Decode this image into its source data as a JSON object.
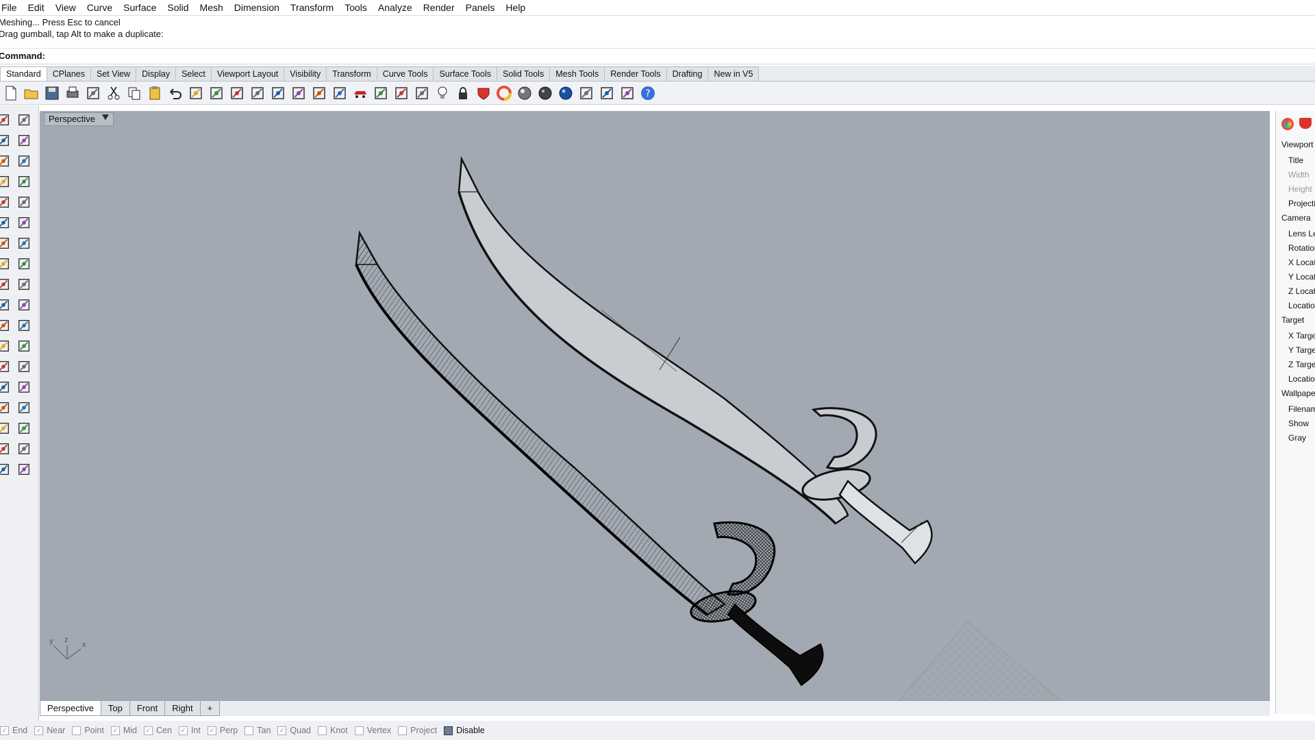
{
  "menu": [
    "File",
    "Edit",
    "View",
    "Curve",
    "Surface",
    "Solid",
    "Mesh",
    "Dimension",
    "Transform",
    "Tools",
    "Analyze",
    "Render",
    "Panels",
    "Help"
  ],
  "history": [
    "Meshing... Press Esc to cancel",
    "Drag gumball, tap Alt to make a duplicate:"
  ],
  "command_label": "Command:",
  "toolbar_tabs": [
    "Standard",
    "CPlanes",
    "Set View",
    "Display",
    "Select",
    "Viewport Layout",
    "Visibility",
    "Transform",
    "Curve Tools",
    "Surface Tools",
    "Solid Tools",
    "Mesh Tools",
    "Render Tools",
    "Drafting",
    "New in V5"
  ],
  "active_toolbar_tab": "Standard",
  "icons": [
    "new-icon",
    "open-icon",
    "save-icon",
    "print-icon",
    "import-icon",
    "cut-icon",
    "copy-icon",
    "paste-icon",
    "undo-icon",
    "pan-icon",
    "move-icon",
    "zoom-icon",
    "zoom-window-icon",
    "zoom-extents-icon",
    "zoom-selected-icon",
    "rotate-view-icon",
    "four-viewports-icon",
    "car-icon",
    "object-properties-icon",
    "circle-icon",
    "snap-icon",
    "light-icon",
    "lock-icon",
    "shield-icon",
    "color-wheel-icon",
    "sphere-icon",
    "sphere-dark-icon",
    "globe-icon",
    "filter-icon",
    "settings-icon",
    "dimension-icon",
    "help-icon"
  ],
  "left_icons": [
    "select-icon",
    "point-icon",
    "line-icon",
    "polyline-icon",
    "circle-icon",
    "curve-icon",
    "rectangle-icon",
    "arc-icon",
    "freeform-icon",
    "surface-icon",
    "box-icon",
    "extrude-icon",
    "loft-icon",
    "plane-icon",
    "boolean-icon",
    "mesh-icon",
    "edit-icon",
    "fillet-icon",
    "transform-icon",
    "grid-icon",
    "array-icon",
    "check-icon",
    "paint-icon"
  ],
  "viewport": {
    "title": "Perspective",
    "axes": {
      "y": "y",
      "z": "z",
      "x": "x"
    }
  },
  "properties": {
    "rows": [
      {
        "label": "Viewport",
        "type": "header"
      },
      {
        "label": "Title",
        "type": "item"
      },
      {
        "label": "Width",
        "type": "dim"
      },
      {
        "label": "Height",
        "type": "dim"
      },
      {
        "label": "Projection",
        "type": "item"
      },
      {
        "label": "Camera",
        "type": "header"
      },
      {
        "label": "Lens Length",
        "type": "item"
      },
      {
        "label": "Rotation",
        "type": "item"
      },
      {
        "label": "X Location",
        "type": "item"
      },
      {
        "label": "Y Location",
        "type": "item"
      },
      {
        "label": "Z Location",
        "type": "item"
      },
      {
        "label": "Location",
        "type": "item"
      },
      {
        "label": "Target",
        "type": "header"
      },
      {
        "label": "X Target",
        "type": "item"
      },
      {
        "label": "Y Target",
        "type": "item"
      },
      {
        "label": "Z Target",
        "type": "item"
      },
      {
        "label": "Location",
        "type": "item"
      },
      {
        "label": "Wallpaper",
        "type": "header"
      },
      {
        "label": "Filename",
        "type": "item"
      },
      {
        "label": "Show",
        "type": "item"
      },
      {
        "label": "Gray",
        "type": "item"
      }
    ]
  },
  "viewport_tabs": [
    "Perspective",
    "Top",
    "Front",
    "Right"
  ],
  "add_tab_glyph": "+",
  "osnaps": [
    {
      "label": "End",
      "checked": true
    },
    {
      "label": "Near",
      "checked": true
    },
    {
      "label": "Point",
      "checked": false
    },
    {
      "label": "Mid",
      "checked": true
    },
    {
      "label": "Cen",
      "checked": true
    },
    {
      "label": "Int",
      "checked": true
    },
    {
      "label": "Perp",
      "checked": true
    },
    {
      "label": "Tan",
      "checked": false
    },
    {
      "label": "Quad",
      "checked": true
    },
    {
      "label": "Knot",
      "checked": false
    },
    {
      "label": "Vertex",
      "checked": false
    },
    {
      "label": "Project",
      "checked": false
    },
    {
      "label": "Disable",
      "checked": true,
      "active": true
    }
  ],
  "colors": {
    "viewport_bg": "#a2a9b2",
    "accent": "#3b6ea5"
  }
}
